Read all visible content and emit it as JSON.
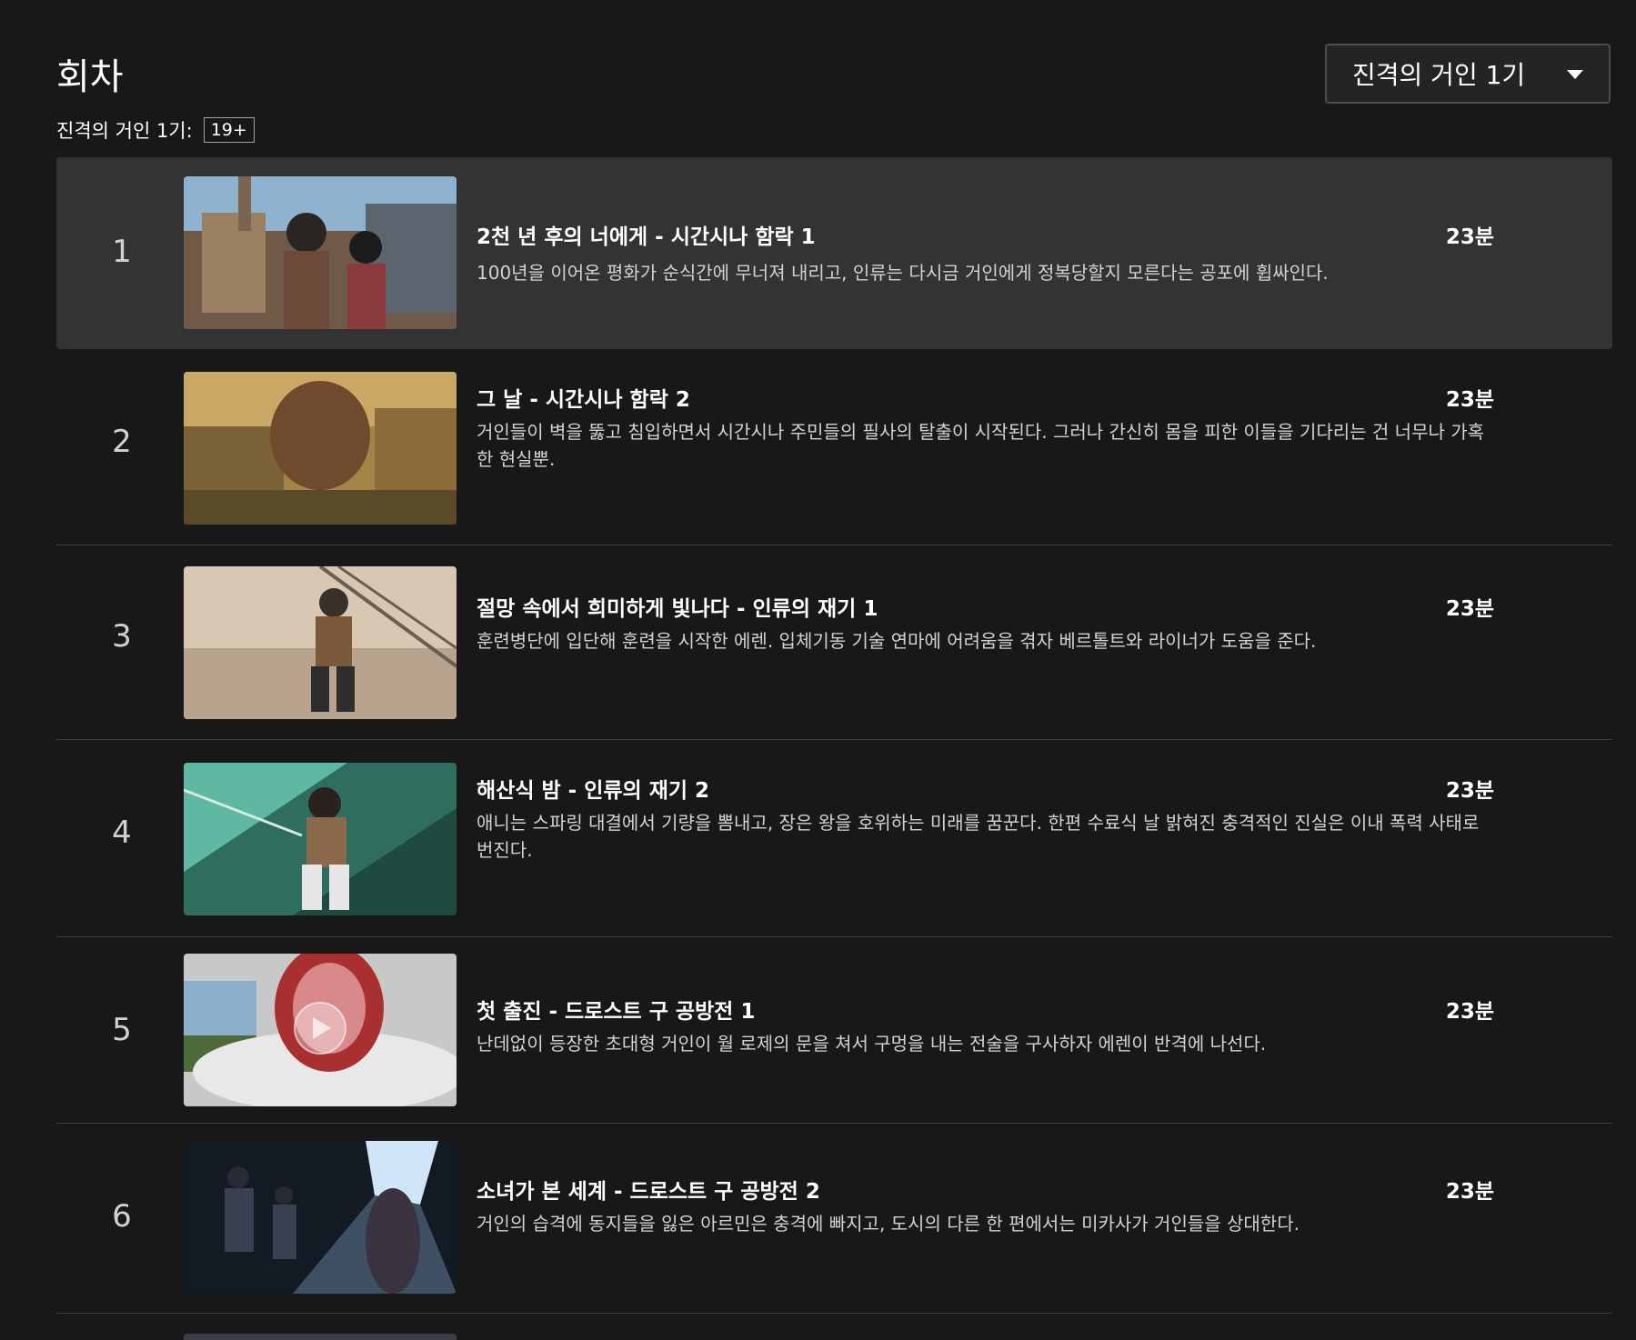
{
  "header": {
    "title": "회차",
    "season_select": "진격의 거인 1기"
  },
  "season_info": {
    "label": "진격의 거인 1기:",
    "rating": "19+"
  },
  "episodes": [
    {
      "number": "1",
      "title": "2천 년 후의 너에게 - 시간시나 함락 1",
      "duration": "23분",
      "description": "100년을 이어온 평화가 순식간에 무너져 내리고, 인류는 다시금 거인에게 정복당할지 모른다는 공포에 휩싸인다."
    },
    {
      "number": "2",
      "title": "그 날 - 시간시나 함락 2",
      "duration": "23분",
      "description": "거인들이 벽을 뚫고 침입하면서 시간시나 주민들의 필사의 탈출이 시작된다. 그러나 간신히 몸을 피한 이들을 기다리는 건 너무나 가혹한 현실뿐."
    },
    {
      "number": "3",
      "title": "절망 속에서 희미하게 빛나다 - 인류의 재기 1",
      "duration": "23분",
      "description": "훈련병단에 입단해 훈련을 시작한 에렌. 입체기동 기술 연마에 어려움을 겪자 베르톨트와 라이너가 도움을 준다."
    },
    {
      "number": "4",
      "title": "해산식 밤 - 인류의 재기 2",
      "duration": "23분",
      "description": "애니는 스파링 대결에서 기량을 뽐내고, 장은 왕을 호위하는 미래를 꿈꾼다. 한편 수료식 날 밝혀진 충격적인 진실은 이내 폭력 사태로 번진다."
    },
    {
      "number": "5",
      "title": "첫 출진 - 드로스트 구 공방전 1",
      "duration": "23분",
      "description": "난데없이 등장한 초대형 거인이 월 로제의 문을 쳐서 구멍을 내는 전술을 구사하자 에렌이 반격에 나선다."
    },
    {
      "number": "6",
      "title": "소녀가 본 세계 - 드로스트 구 공방전 2",
      "duration": "23분",
      "description": "거인의 습격에 동지들을 잃은 아르민은 충격에 빠지고, 도시의 다른 한 편에서는 미카사가 거인들을 상대한다."
    }
  ],
  "colors": {
    "background": "#181818",
    "active_row": "#333333",
    "divider": "#404040",
    "text_primary": "#ffffff",
    "text_secondary": "#d2d2d2"
  }
}
